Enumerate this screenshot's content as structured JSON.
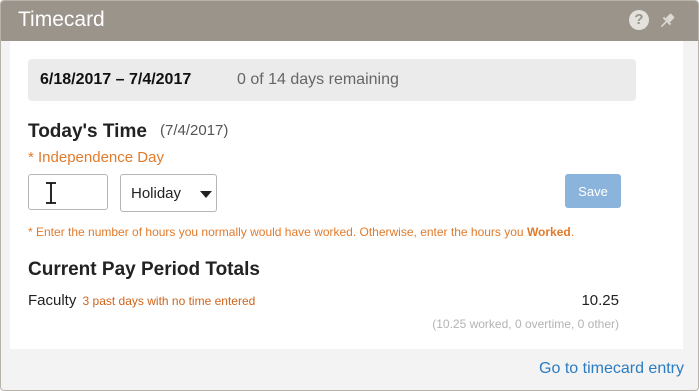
{
  "header": {
    "title": "Timecard",
    "help_symbol": "?",
    "icons": [
      "help-icon",
      "pin-icon"
    ]
  },
  "period": {
    "dates": "6/18/2017 – 7/4/2017",
    "remaining": "0 of 14 days remaining"
  },
  "today": {
    "heading": "Today's Time",
    "date": "(7/4/2017)",
    "holiday": "* Independence Day",
    "hours_value": "",
    "type_selected": "Holiday",
    "save_label": "Save",
    "hint": "* Enter the number of hours you normally would have worked.  Otherwise, enter the hours you ",
    "hint_emphasis": "Worked",
    "hint_end": "."
  },
  "totals": {
    "heading": "Current Pay Period Totals",
    "label": "Faculty",
    "warning": "3 past days with no time entered",
    "value": "10.25",
    "breakdown": "(10.25 worked, 0 overtime, 0 other)"
  },
  "footer": {
    "link": "Go to timecard entry"
  },
  "colors": {
    "header_bg": "#9a948a",
    "accent_orange": "#e07b2c",
    "save_button": "#8bb4dc",
    "link_blue": "#2b7cc1"
  }
}
